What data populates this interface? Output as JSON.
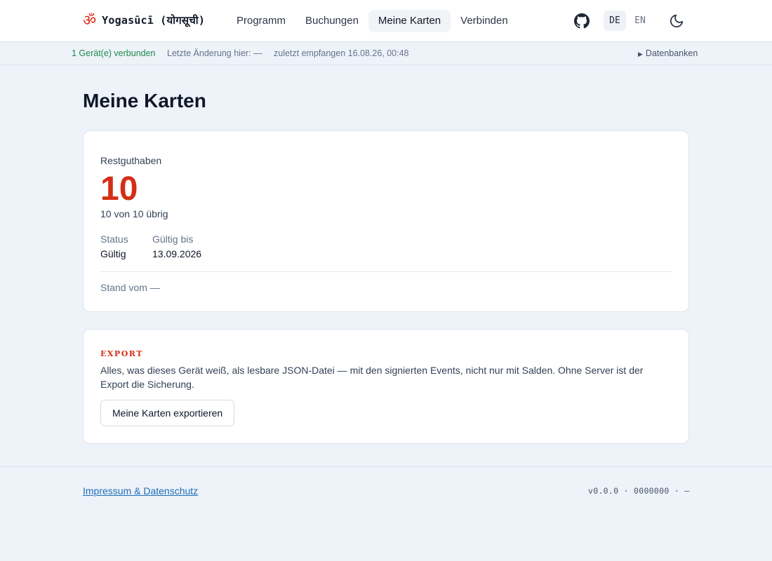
{
  "header": {
    "logo_symbol": "ॐ",
    "logo_text": "Yogasūcī (योगसूची)",
    "nav": [
      {
        "label": "Programm",
        "active": false
      },
      {
        "label": "Buchungen",
        "active": false
      },
      {
        "label": "Meine Karten",
        "active": true
      },
      {
        "label": "Verbinden",
        "active": false
      }
    ],
    "github_icon": "github-icon",
    "languages": [
      {
        "label": "DE",
        "active": true
      },
      {
        "label": "EN",
        "active": false
      }
    ],
    "theme_icon": "moon-icon"
  },
  "statusbar": {
    "connected": "1 Gerät(e) verbunden",
    "last_change": "Letzte Änderung hier: —",
    "last_received": "zuletzt empfangen 16.08.26, 00:48",
    "databases": "Datenbanken"
  },
  "main": {
    "title": "Meine Karten",
    "card": {
      "balance_label": "Restguthaben",
      "balance_value": "10",
      "balance_sub": "10 von 10 übrig",
      "status_label": "Status",
      "status_value": "Gültig",
      "valid_label": "Gültig bis",
      "valid_value": "13.09.2026",
      "stand": "Stand vom —"
    },
    "export": {
      "title": "EXPORT",
      "description": "Alles, was dieses Gerät weiß, als lesbare JSON-Datei — mit den signierten Events, nicht nur mit Salden. Ohne Server ist der Export die Sicherung.",
      "button": "Meine Karten exportieren"
    }
  },
  "footer": {
    "link": "Impressum & Datenschutz",
    "version": "v0.0.0 · 0000000 · —"
  },
  "colors": {
    "accent_red": "#d32f17",
    "connected_green": "#1f8a4c",
    "link_blue": "#1d6fb8",
    "background": "#eef2f9"
  }
}
